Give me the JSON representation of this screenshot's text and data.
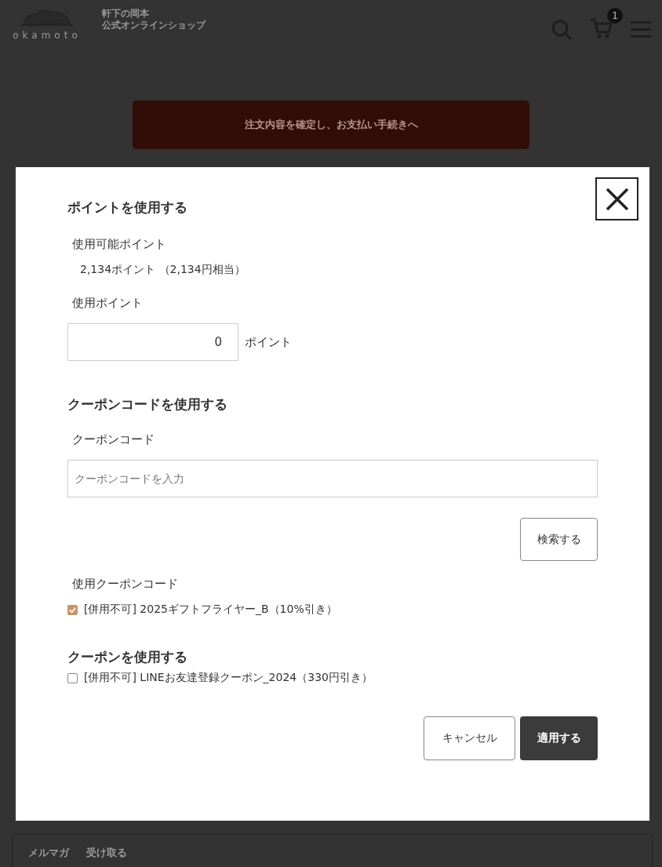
{
  "header": {
    "logo_text": "okamoto",
    "shop_name_line1": "軒下の岡本",
    "shop_name_line2": "公式オンラインショップ",
    "cart_count": "1"
  },
  "checkout_button": "注文内容を確定し、お支払い手続きへ",
  "modal": {
    "points_title": "ポイントを使用する",
    "available_label": "使用可能ポイント",
    "available_value": "2,134ポイント （2,134円相当）",
    "use_label": "使用ポイント",
    "use_value": "0",
    "use_unit": "ポイント",
    "coupon_code_title": "クーポンコードを使用する",
    "coupon_code_label": "クーポンコード",
    "coupon_code_placeholder": "クーポンコードを入力",
    "search_button": "検索する",
    "used_code_label": "使用クーポンコード",
    "used_codes": [
      {
        "label": "[併用不可] 2025ギフトフライヤー_B（10%引き）",
        "checked": true
      }
    ],
    "coupons_title": "クーポンを使用する",
    "coupons": [
      {
        "label": "[併用不可] LINEお友達登録クーポン_2024（330円引き）",
        "checked": false
      }
    ],
    "cancel_button": "キャンセル",
    "apply_button": "適用する"
  },
  "newsletter": {
    "label": "メルマガ",
    "value": "受け取る"
  }
}
